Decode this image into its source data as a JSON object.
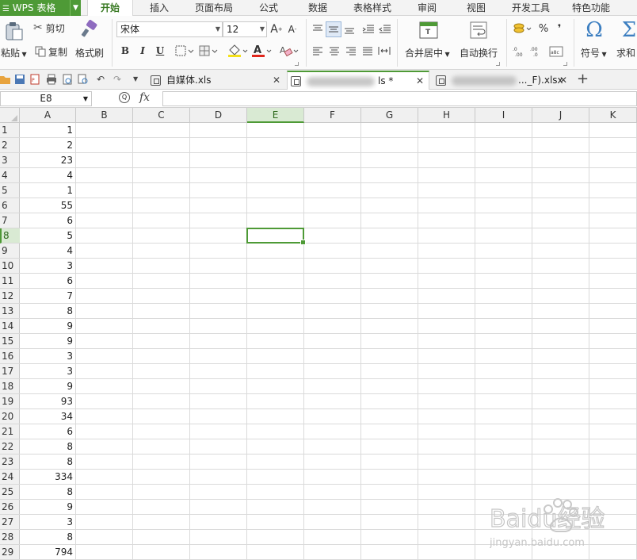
{
  "app": {
    "menu_label": "WPS 表格",
    "tabs": [
      {
        "label": "开始",
        "active": true
      },
      {
        "label": "插入"
      },
      {
        "label": "页面布局"
      },
      {
        "label": "公式"
      },
      {
        "label": "数据"
      },
      {
        "label": "表格样式"
      },
      {
        "label": "审阅"
      },
      {
        "label": "视图"
      },
      {
        "label": "开发工具"
      },
      {
        "label": "特色功能"
      }
    ]
  },
  "ribbon": {
    "paste": "粘贴",
    "cut": "剪切",
    "copy": "复制",
    "format_painter": "格式刷",
    "font_name": "宋体",
    "font_size": "12",
    "bold": "B",
    "italic": "I",
    "underline": "U",
    "merge_center": "合并居中",
    "wrap_text": "自动换行",
    "percent": "%",
    "comma": "❜",
    "symbol": "符号",
    "sum": "求和"
  },
  "doc_tabs": [
    {
      "label": "自媒体.xls",
      "active": false
    },
    {
      "label": "ls *",
      "active": true
    },
    {
      "label": "..._F).xlsx",
      "active": false
    }
  ],
  "formula_bar": {
    "name_box": "E8",
    "fx": "fx",
    "value": ""
  },
  "grid": {
    "columns": [
      "A",
      "B",
      "C",
      "D",
      "E",
      "F",
      "G",
      "H",
      "I",
      "J",
      "K"
    ],
    "selected_column": "E",
    "selected_row": 8,
    "row_numbers": [
      "1",
      "2",
      "3",
      "4",
      "5",
      "6",
      "7",
      "8",
      "9",
      "10",
      "11",
      "12",
      "13",
      "14",
      "15",
      "16",
      "17",
      "18",
      "19",
      "20",
      "21",
      "22",
      "23",
      "24",
      "25",
      "26",
      "27",
      "28",
      "29"
    ],
    "column_a": [
      "1",
      "2",
      "23",
      "4",
      "1",
      "55",
      "6",
      "5",
      "4",
      "3",
      "6",
      "7",
      "8",
      "9",
      "9",
      "3",
      "3",
      "9",
      "93",
      "34",
      "6",
      "8",
      "8",
      "334",
      "8",
      "9",
      "3",
      "8",
      "794"
    ]
  },
  "watermark": {
    "brand": "Baidu经验",
    "url": "jingyan.baidu.com"
  },
  "colors": {
    "accent": "#4e9a36",
    "selection_header": "#d9ead3"
  }
}
